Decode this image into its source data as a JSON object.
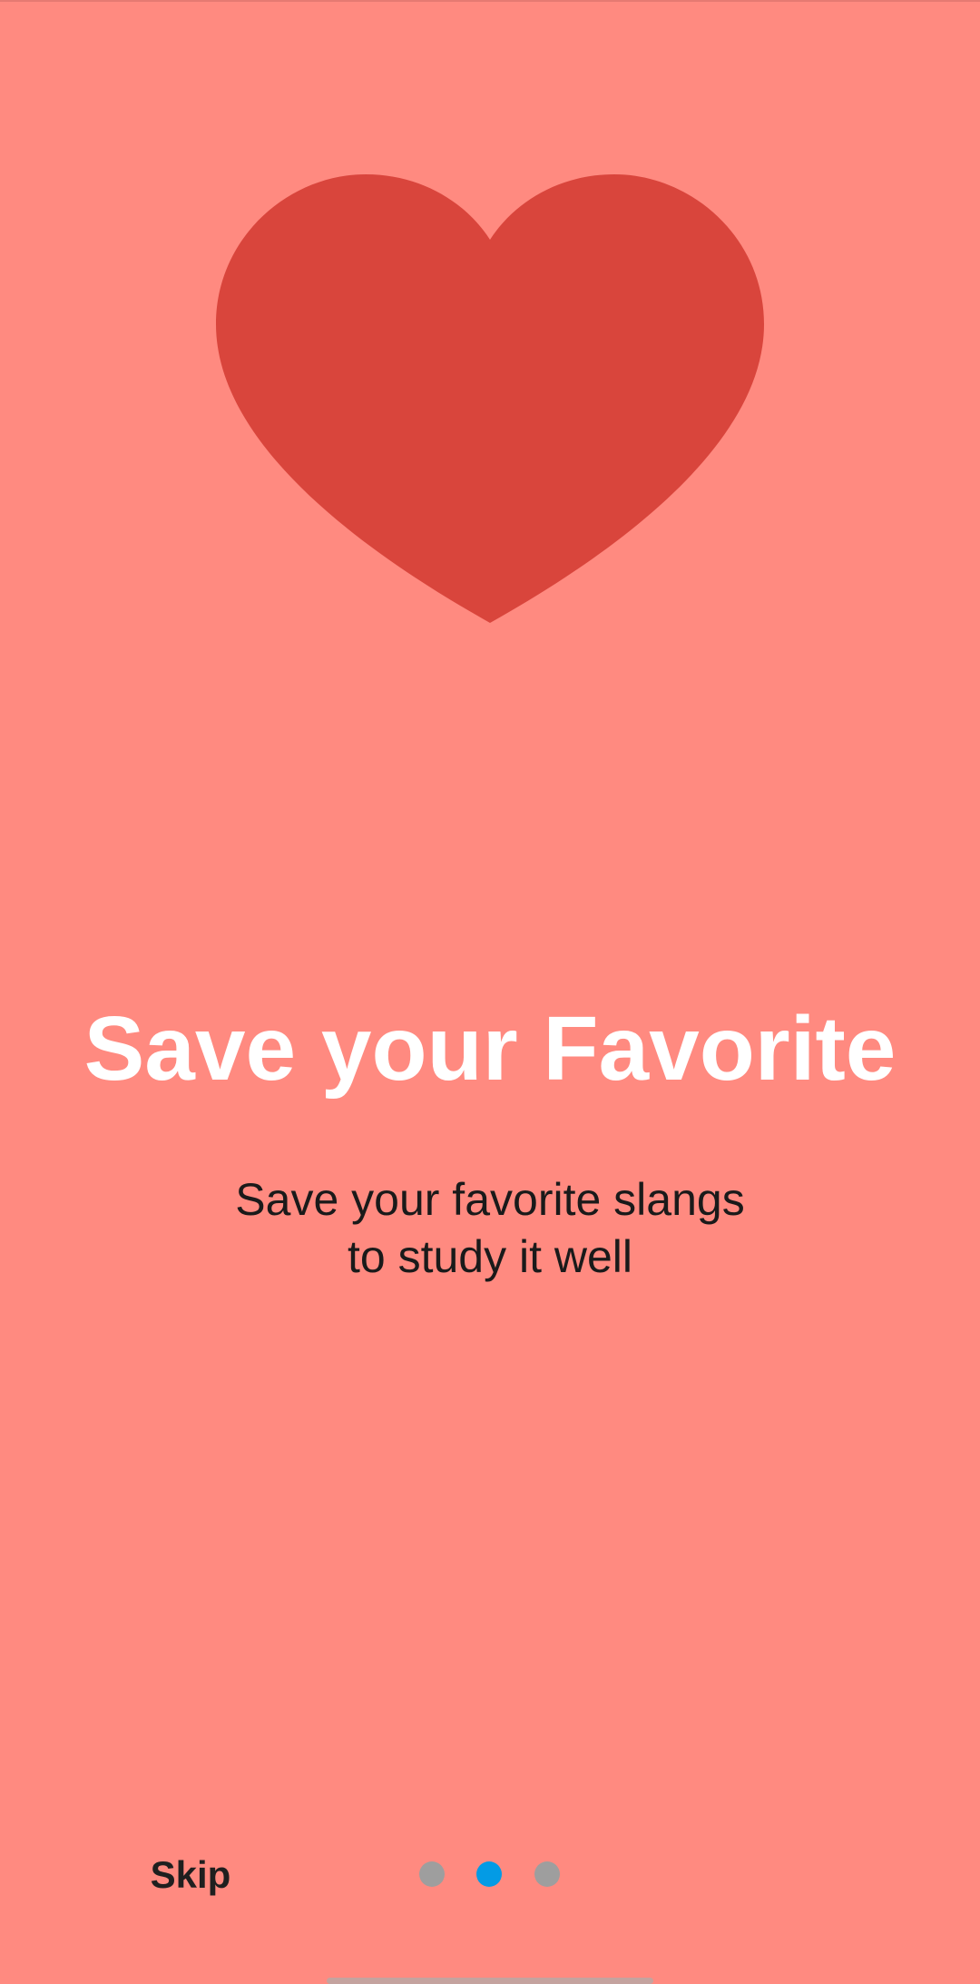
{
  "onboarding": {
    "title": "Save your Favorite",
    "subtitle_line1": "Save your favorite slangs",
    "subtitle_line2": "to study it well",
    "hero_icon": "heart-icon",
    "skip_label": "Skip",
    "current_page": 2,
    "total_pages": 3
  },
  "colors": {
    "background": "#ff8a80",
    "heart": "#d9453c",
    "title": "#ffffff",
    "subtitle": "#1a1a1a",
    "dot_active": "#039be5",
    "dot_inactive": "#9e9e9e"
  }
}
